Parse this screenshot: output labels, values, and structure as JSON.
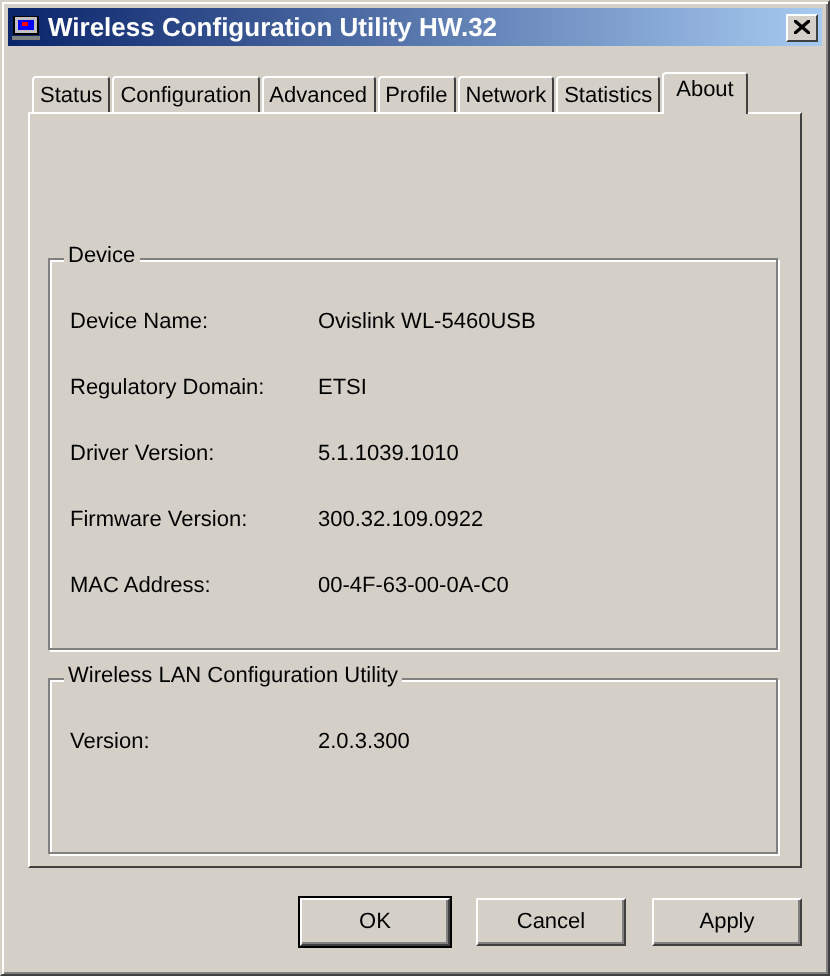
{
  "window": {
    "title": "Wireless Configuration Utility HW.32"
  },
  "tabs": [
    {
      "label": "Status",
      "selected": false
    },
    {
      "label": "Configuration",
      "selected": false
    },
    {
      "label": "Advanced",
      "selected": false
    },
    {
      "label": "Profile",
      "selected": false
    },
    {
      "label": "Network",
      "selected": false
    },
    {
      "label": "Statistics",
      "selected": false
    },
    {
      "label": "About",
      "selected": true
    }
  ],
  "groups": [
    {
      "title": "Device",
      "rows": [
        {
          "label": "Device Name:",
          "value": "Ovislink WL-5460USB"
        },
        {
          "label": "Regulatory Domain:",
          "value": "ETSI"
        },
        {
          "label": "Driver Version:",
          "value": "5.1.1039.1010"
        },
        {
          "label": "Firmware Version:",
          "value": "300.32.109.0922"
        },
        {
          "label": "MAC Address:",
          "value": "00-4F-63-00-0A-C0"
        }
      ]
    },
    {
      "title": "Wireless LAN Configuration Utility",
      "rows": [
        {
          "label": "Version:",
          "value": "2.0.3.300"
        }
      ]
    }
  ],
  "buttons": [
    {
      "label": "OK",
      "default": true
    },
    {
      "label": "Cancel",
      "default": false
    },
    {
      "label": "Apply",
      "default": false
    }
  ]
}
